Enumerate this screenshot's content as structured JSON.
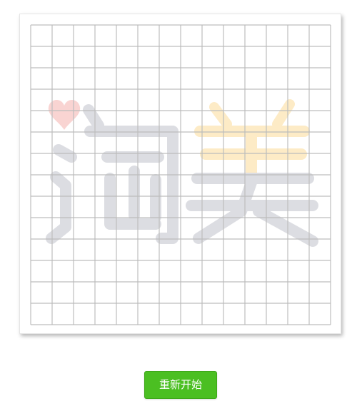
{
  "board": {
    "columns": 14,
    "rows": 14,
    "grid_color": "#bdbdbd",
    "background": "#ffffff"
  },
  "watermark": {
    "text": "淘美",
    "char_color": "#dcdde2",
    "heart_color": "#f9d4d2",
    "accent_color": "#fdebc6"
  },
  "controls": {
    "restart_label": "重新开始",
    "restart_color": "#4bbf22"
  }
}
